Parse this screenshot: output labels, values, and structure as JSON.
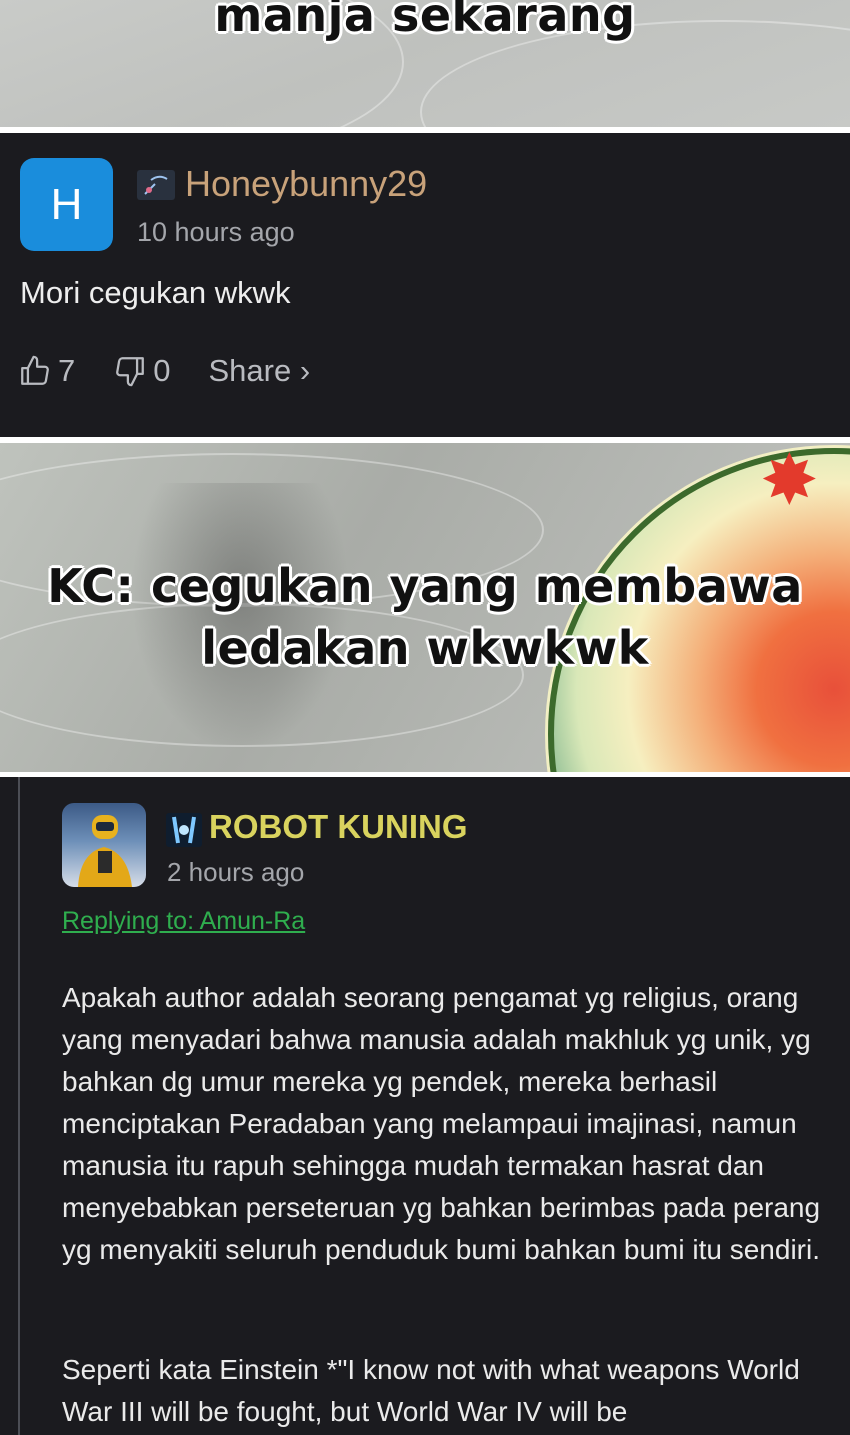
{
  "top_caption": "manja sekarang",
  "comment_1": {
    "avatar_letter": "H",
    "username": "Honeybunny29",
    "timestamp": "10 hours ago",
    "text": "Mori cegukan wkwk",
    "likes": "7",
    "dislikes": "0",
    "share_label": "Share ›"
  },
  "mid_caption": {
    "line1": "KC: cegukan yang membawa",
    "line2": "ledakan wkwkwk"
  },
  "comment_2": {
    "username": "ROBOT KUNING",
    "timestamp": "2 hours ago",
    "reply_to": "Replying to: Amun-Ra",
    "paragraph_1": "Apakah author adalah seorang pengamat yg religius, orang yang menyadari bahwa manusia adalah makhluk yg unik, yg bahkan dg umur mereka yg pendek, mereka berhasil menciptakan Peradaban yang melampaui imajinasi, namun manusia itu rapuh sehingga mudah termakan hasrat dan menyebabkan perseteruan yg bahkan berimbas pada perang yg menyakiti seluruh penduduk bumi bahkan bumi itu sendiri.",
    "paragraph_2": "Seperti kata Einstein *\"I know not with what weapons World War III will be fought, but World War IV will be"
  },
  "colors": {
    "comment_bg": "#1b1b1f",
    "username_1": "#c8a27a",
    "username_2": "#d9d35e",
    "reply_link": "#2fae4e",
    "avatar_h_bg": "#1a8ddc"
  }
}
